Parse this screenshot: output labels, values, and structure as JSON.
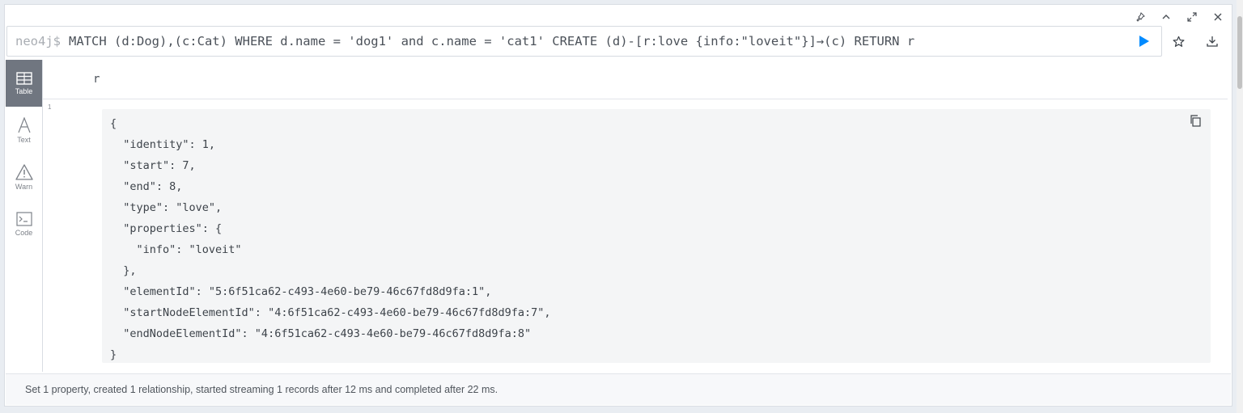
{
  "window_controls": [
    "pin-icon",
    "chevron-up-icon",
    "expand-icon",
    "close-icon"
  ],
  "editor": {
    "prompt": "neo4j$",
    "query": "MATCH (d:Dog),(c:Cat) WHERE d.name = 'dog1' and c.name = 'cat1' CREATE (d)-[r:love {info:\"loveit\"}]→(c) RETURN r"
  },
  "editor_actions": [
    "play-icon",
    "star-icon",
    "download-icon"
  ],
  "sidebar": {
    "items": [
      {
        "label": "Table",
        "icon": "table-icon",
        "active": true
      },
      {
        "label": "Text",
        "icon": "text-icon",
        "active": false
      },
      {
        "label": "Warn",
        "icon": "warning-icon",
        "active": false
      },
      {
        "label": "Code",
        "icon": "code-icon",
        "active": false
      }
    ]
  },
  "result": {
    "column": "r",
    "row_number": "1",
    "json_lines": [
      "{",
      "  \"identity\": 1,",
      "  \"start\": 7,",
      "  \"end\": 8,",
      "  \"type\": \"love\",",
      "  \"properties\": {",
      "    \"info\": \"loveit\"",
      "  },",
      "  \"elementId\": \"5:6f51ca62-c493-4e60-be79-46c67fd8d9fa:1\",",
      "  \"startNodeElementId\": \"4:6f51ca62-c493-4e60-be79-46c67fd8d9fa:7\",",
      "  \"endNodeElementId\": \"4:6f51ca62-c493-4e60-be79-46c67fd8d9fa:8\"",
      "}"
    ]
  },
  "footer": {
    "status": "Set 1 property, created 1 relationship, started streaming 1 records after 12 ms and completed after 22 ms."
  },
  "colors": {
    "accent": "#018bff",
    "active_tab": "#707680"
  }
}
